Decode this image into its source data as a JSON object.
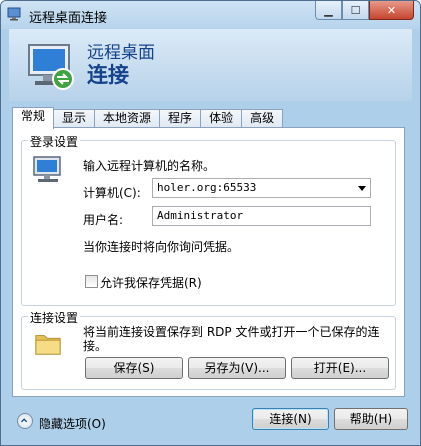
{
  "window": {
    "title": "远程桌面连接"
  },
  "header": {
    "line1": "远程桌面",
    "line2": "连接"
  },
  "tabs": [
    "常规",
    "显示",
    "本地资源",
    "程序",
    "体验",
    "高级"
  ],
  "login": {
    "group_title": "登录设置",
    "instruction": "输入远程计算机的名称。",
    "computer_label": "计算机(C):",
    "computer_value": "holer.org:65533",
    "user_label": "用户名:",
    "user_value": "Administrator",
    "credential_note": "当你连接时将向你询问凭据。",
    "allow_save_label": "允许我保存凭据(R)"
  },
  "connection": {
    "group_title": "连接设置",
    "description": "将当前连接设置保存到 RDP 文件或打开一个已保存的连接。",
    "save_label": "保存(S)",
    "save_as_label": "另存为(V)...",
    "open_label": "打开(E)..."
  },
  "footer": {
    "hide_options": "隐藏选项(O)",
    "connect_label": "连接(N)",
    "help_label": "帮助(H)"
  },
  "colors": {
    "accent": "#15428b",
    "frame": "#aecfe9"
  }
}
